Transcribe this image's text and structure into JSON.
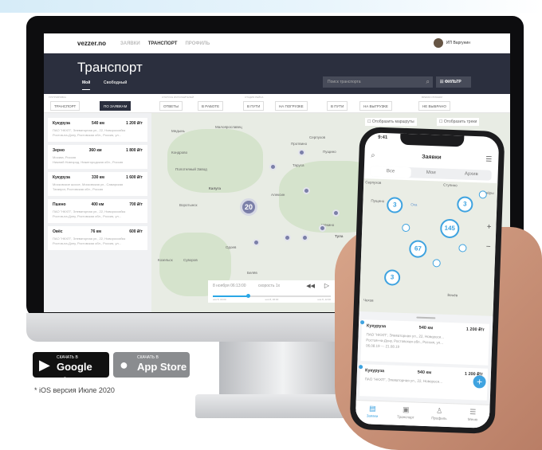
{
  "desktop": {
    "logo": "vezzer.no",
    "nav": [
      "ЗАЯВКИ",
      "ТРАНСПОРТ",
      "ПРОФИЛЬ"
    ],
    "nav_active": 1,
    "user": "ИП Варгунин",
    "title": "Транспорт",
    "subtabs": [
      "Мой",
      "Свободный"
    ],
    "search_placeholder": "Поиск транспорта",
    "filter_label": "ФИЛЬТР",
    "groups": {
      "grouping": "ГРУППИРОВКА",
      "statuses": "СТАТУСЫ ИСПОЛНИТЕЛЕЙ",
      "stage": "СТАДИЯ РЕЙСА",
      "time": "ВРЕМЯ СТОЯНКИ"
    },
    "chips": [
      "ТРАНСПОРТ",
      "ПО ЗАЯВКАМ",
      "ОТВЕТЫ",
      "В РАБОТЕ",
      "В ПУТИ",
      "НА ПОГРУЗКЕ",
      "В ПУТИ",
      "НА ВЫГРУЗКЕ",
      "НЕ ВЫБРАНО"
    ],
    "cards": [
      {
        "cargo": "Кукуруза",
        "distance": "540 км",
        "price": "1 200 ₽/т",
        "from": "ПАО \"НКХП\", Элеваторная ул., 22, Новороссийск",
        "to": "Ростов-на-Дону, Ростовская обл., Россия, ул..."
      },
      {
        "cargo": "Зерно",
        "distance": "360 км",
        "price": "1 800 ₽/т",
        "from": "Москва, Россия",
        "to": "Нижний Новгород, Нижегородская обл., Россия"
      },
      {
        "cargo": "Кукуруза",
        "distance": "330 км",
        "price": "1 600 ₽/т",
        "from": "Московское шоссе, Московская ул., Самарская",
        "to": "Таганрог, Ростовская обл., Россия"
      },
      {
        "cargo": "Пшено",
        "distance": "400 км",
        "price": "700 ₽/т",
        "from": "ПАО \"НКХП\", Элеваторная ул., 22, Новороссийск",
        "to": "Ростов-на-Дону, Ростовская обл., Россия, ул..."
      },
      {
        "cargo": "Овёс",
        "distance": "76 км",
        "price": "600 ₽/т",
        "from": "ПАО \"НКХП\", Элеваторная ул., 22, Новороссийск",
        "to": "Ростов-на-Дону, Ростовская обл., Россия, ул..."
      }
    ],
    "map": {
      "show_routes": "Отобразить маршруты",
      "show_tracks": "Отобразить треки",
      "cluster": "20",
      "cities": [
        "Малоярославец",
        "Медынь",
        "Кондрово",
        "Полотняный Завод",
        "Калуга",
        "Воротынск",
        "Алексин",
        "Серпухов",
        "Протвино",
        "Таруса",
        "Пущино",
        "Тула",
        "Одоев",
        "Козельск",
        "Суворов",
        "Белёв",
        "Щёкино"
      ],
      "player_date": "8 ноября 06:13:00",
      "player_speed": "скорость 1х",
      "progress": 0.3,
      "ticks": [
        "ноя 8, 00:00",
        "ноя 8, 06:00",
        "ноя 8, 12:00"
      ]
    }
  },
  "phone": {
    "time": "9:41",
    "title": "Заявки",
    "segments": [
      "Все",
      "Мои",
      "Архив"
    ],
    "cities": [
      "Серпухов",
      "Ступино",
      "Пущино",
      "Ока",
      "Озёры",
      "Венёв",
      "Чехов"
    ],
    "clusters": [
      "3",
      "3",
      "145",
      "67",
      "3"
    ],
    "cards": [
      {
        "cargo": "Кукуруза",
        "distance": "540 км",
        "price": "1 200 ₽/т",
        "from": "ПАО \"НКХП\", Элеваторная ул., 22, Новороси...",
        "to": "Ростов-на-Дону, Ростовская обл., Россия, ул...",
        "dates": "06.08.19 — 21.08.19"
      },
      {
        "cargo": "Кукуруза",
        "distance": "540 км",
        "price": "1 200 ₽/т",
        "from": "ПАО \"НКХП\", Элеваторная ул., 22, Новороси...",
        "to": ""
      }
    ],
    "tabs": [
      "Заявки",
      "Транспорт",
      "Профиль",
      "Меню"
    ]
  },
  "stores": {
    "google_small": "СКАЧАТЬ В",
    "google": "Google Play",
    "apple_small": "СКАЧАТЬ В",
    "apple": "App Store",
    "note": "* iOS версия Июле 2020"
  },
  "colors": {
    "header": "#2b2f3e",
    "accent": "#3fa3e0",
    "marker": "#7b7fa8"
  }
}
